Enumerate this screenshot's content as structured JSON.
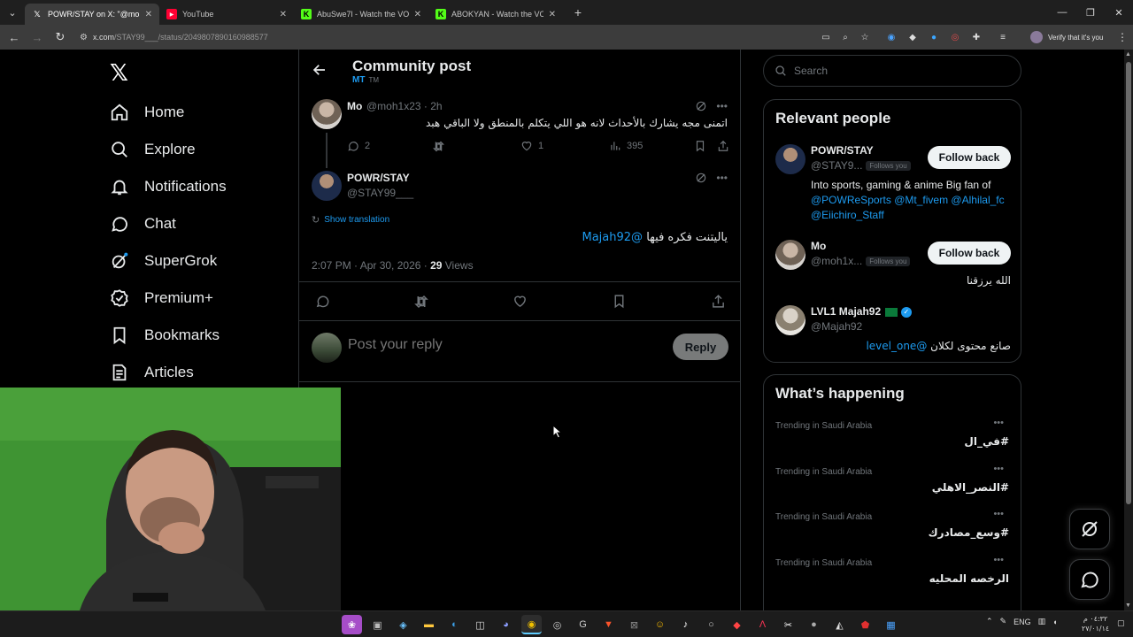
{
  "browser": {
    "tabs": [
      {
        "title": "POWR/STAY on X: \"@moh1x23",
        "icon": "x-icon",
        "active": true
      },
      {
        "title": "YouTube",
        "icon": "youtube-icon",
        "active": false
      },
      {
        "title": "AbuSwe7l - Watch the VOD on",
        "icon": "kick-icon",
        "active": false
      },
      {
        "title": "ABOKYAN - Watch the VOD on",
        "icon": "kick-icon",
        "active": false
      }
    ],
    "url_host": "x.com",
    "url_path": "/STAY99___/status/2049807890160988577",
    "profile_label": "Verify that it's you"
  },
  "nav": {
    "items": [
      {
        "label": "Home",
        "icon": "home-icon"
      },
      {
        "label": "Explore",
        "icon": "search-icon"
      },
      {
        "label": "Notifications",
        "icon": "bell-icon"
      },
      {
        "label": "Chat",
        "icon": "chat-icon"
      },
      {
        "label": "SuperGrok",
        "icon": "grok-icon"
      },
      {
        "label": "Premium+",
        "icon": "verified-icon"
      },
      {
        "label": "Bookmarks",
        "icon": "bookmark-icon"
      },
      {
        "label": "Articles",
        "icon": "articles-icon"
      }
    ]
  },
  "header": {
    "title": "Community post",
    "community": "MT",
    "community_tag": "TM"
  },
  "post1": {
    "name": "Mo",
    "handle": "@moh1x23 · 2h",
    "text": "اتمنى مجه يشارك بالأحداث لانه هو اللي يتكلم بالمنطق ولا الباقي هبد",
    "replies": "2",
    "likes": "1",
    "views": "395"
  },
  "post2": {
    "name": "POWR/STAY",
    "handle": "@STAY99___",
    "show_translation": "Show translation",
    "text": "ياليتنت  فكره فيها",
    "mention": "@Majah92",
    "timestamp": "2:07 PM · Apr 30, 2026 · ",
    "views_count": "29",
    "views_label": " Views"
  },
  "reply": {
    "placeholder": "Post your reply",
    "button": "Reply"
  },
  "search": {
    "placeholder": "Search"
  },
  "relevant": {
    "title": "Relevant people",
    "people": [
      {
        "name": "POWR/STAY",
        "handle": "@STAY9...",
        "badge": "Follows you",
        "button": "Follow back",
        "bio_text": "Into sports, gaming & anime Big fan of",
        "bio_links": [
          "@POWReSports",
          "@Mt_fivem",
          "@Alhilal_fc",
          "@Eiichiro_Staff"
        ]
      },
      {
        "name": "Mo",
        "handle": "@moh1x...",
        "badge": "Follows you",
        "button": "Follow back",
        "bio_text": "الله يرزقنا"
      },
      {
        "name": "LVL1 Majah92",
        "handle": "@Majah92",
        "bio_text": "صانع محتوى لكلان",
        "bio_link": "@level_one"
      }
    ]
  },
  "happening": {
    "title": "What’s happening",
    "trends": [
      {
        "category": "Trending in Saudi Arabia",
        "name": "#في_ال"
      },
      {
        "category": "Trending in Saudi Arabia",
        "name": "#النصر_الاهلي"
      },
      {
        "category": "Trending in Saudi Arabia",
        "name": "#وسع_مصادرك"
      },
      {
        "category": "Trending in Saudi Arabia",
        "name": "الرخصه المحليه"
      }
    ]
  },
  "taskbar": {
    "language": "ENG",
    "time": "٠٤:٣٢ م",
    "date": "٢٧/٠١/١٤"
  },
  "colors": {
    "accent": "#1d9bf0",
    "muted": "#71767b",
    "border": "#2f3336",
    "text": "#e7e9ea"
  }
}
